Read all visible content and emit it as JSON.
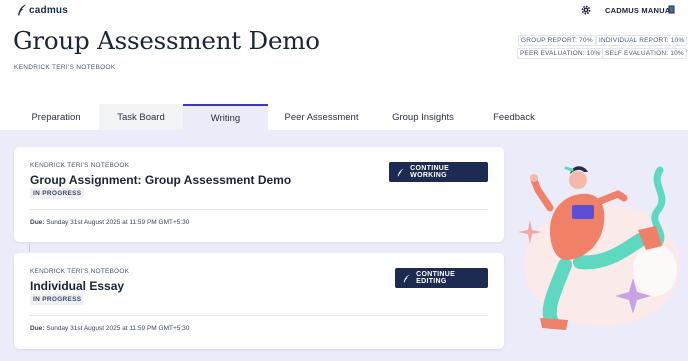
{
  "brand": {
    "name": "cadmus"
  },
  "header": {
    "manual_label": "CADMUS MANUAL",
    "title": "Group Assessment Demo",
    "subtitle": "KENDRICK TERI'S NOTEBOOK"
  },
  "stats": {
    "group_report": "GROUP REPORT: 70%",
    "individual_report": "INDIVIDUAL REPORT: 10%",
    "peer_evaluation": "PEER EVALUATION: 10%",
    "self_evaluation": "SELF EVALUATION: 10%"
  },
  "tabs": [
    {
      "label": "Preparation",
      "state": "default"
    },
    {
      "label": "Task Board",
      "state": "shaded"
    },
    {
      "label": "Writing",
      "state": "active"
    },
    {
      "label": "Peer Assessment",
      "state": "default"
    },
    {
      "label": "Group Insights",
      "state": "default"
    },
    {
      "label": "Feedback",
      "state": "default"
    }
  ],
  "cards": [
    {
      "notebook": "KENDRICK TERI'S NOTEBOOK",
      "title": "Group Assignment: Group Assessment Demo",
      "status": "IN PROGRESS",
      "due_label": "Due:",
      "due_value": " Sunday 31st August 2025 at 11:59 PM GMT+5:30",
      "button_label": "CONTINUE WORKING"
    },
    {
      "notebook": "KENDRICK TERI'S NOTEBOOK",
      "title": "Individual Essay",
      "status": "IN PROGRESS",
      "due_label": "Due:",
      "due_value": " Sunday 31st August 2025 at 11:59 PM GMT+5:30",
      "button_label": "CONTINUE EDITING"
    }
  ],
  "icons": {
    "logo": "cadmus-feather-logo",
    "settings": "gear-icon",
    "manual": "book-icon",
    "button": "feather-pen-icon"
  },
  "colors": {
    "accent": "#3b34c9",
    "button_bg": "#1d2b52",
    "content_bg": "#ecebf9",
    "illustration_teal": "#5fd8c2",
    "illustration_coral": "#f08068"
  }
}
